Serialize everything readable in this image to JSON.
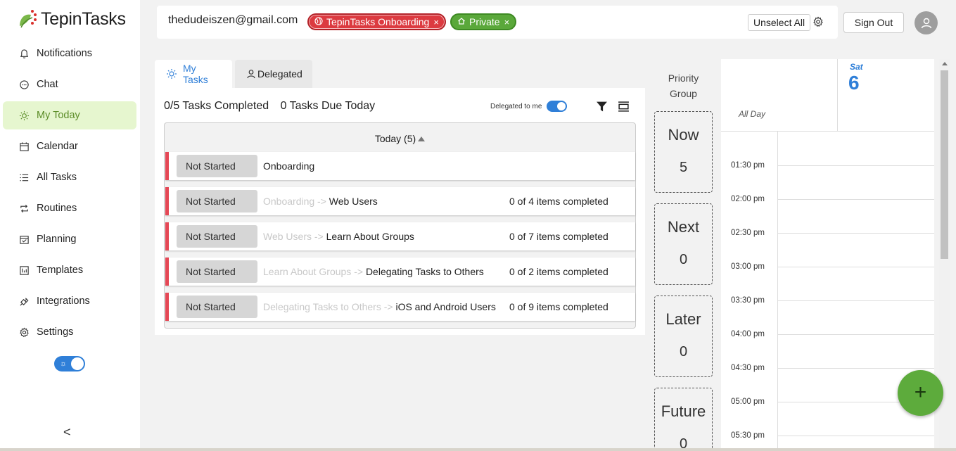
{
  "app": {
    "name": "TepinTasks",
    "brand_color": "#5aa83a",
    "accent_color": "#2f7fd8"
  },
  "sidebar": {
    "items": [
      {
        "label": "Notifications",
        "icon": "bell-icon"
      },
      {
        "label": "Chat",
        "icon": "chat-bubble-icon"
      },
      {
        "label": "My Today",
        "icon": "sun-icon",
        "active": true
      },
      {
        "label": "Calendar",
        "icon": "calendar-icon"
      },
      {
        "label": "All Tasks",
        "icon": "list-icon"
      },
      {
        "label": "Routines",
        "icon": "repeat-icon"
      },
      {
        "label": "Planning",
        "icon": "calendar-check-icon"
      },
      {
        "label": "Templates",
        "icon": "template-icon"
      },
      {
        "label": "Integrations",
        "icon": "plug-icon"
      },
      {
        "label": "Settings",
        "icon": "gear-icon"
      }
    ],
    "collapse_label": "<"
  },
  "topbar": {
    "email": "thedudeiszen@gmail.com",
    "chips": [
      {
        "label": "TepinTasks Onboarding",
        "icon": "globe-icon",
        "color": "#dc3a40"
      },
      {
        "label": "Private",
        "icon": "home-icon",
        "color": "#5aa83a"
      }
    ],
    "chip_close": "×",
    "unselect_all": "Unselect All",
    "sign_out": "Sign Out"
  },
  "tabs": {
    "my_tasks": "My Tasks",
    "delegated": "Delegated"
  },
  "tasks": {
    "completed_summary": "0/5 Tasks Completed",
    "due_summary": "0 Tasks Due Today",
    "delegated_toggle_label": "Delegated to me",
    "group_header": "Today (5)",
    "rows": [
      {
        "status": "Not Started",
        "parent": "",
        "title": "Onboarding",
        "progress": ""
      },
      {
        "status": "Not Started",
        "parent": "Onboarding -> ",
        "title": "Web Users",
        "progress": "0 of 4 items completed"
      },
      {
        "status": "Not Started",
        "parent": "Web Users -> ",
        "title": "Learn About Groups",
        "progress": "0 of 7 items completed"
      },
      {
        "status": "Not Started",
        "parent": "Learn About Groups -> ",
        "title": "Delegating Tasks to Others",
        "progress": "0 of 2 items completed"
      },
      {
        "status": "Not Started",
        "parent": "Delegating Tasks to Others -> ",
        "title": "iOS and Android Users",
        "progress": "0 of 9 items completed"
      }
    ]
  },
  "priority": {
    "title_line1": "Priority",
    "title_line2": "Group",
    "groups": [
      {
        "label": "Now",
        "count": "5"
      },
      {
        "label": "Next",
        "count": "0"
      },
      {
        "label": "Later",
        "count": "0"
      },
      {
        "label": "Future",
        "count": "0"
      }
    ]
  },
  "calendar": {
    "all_day": "All Day",
    "day_name": "Sat",
    "day_number": "6",
    "times": [
      "01:30 pm",
      "02:00 pm",
      "02:30 pm",
      "03:00 pm",
      "03:30 pm",
      "04:00 pm",
      "04:30 pm",
      "05:00 pm",
      "05:30 pm"
    ]
  },
  "fab": {
    "label": "+"
  }
}
